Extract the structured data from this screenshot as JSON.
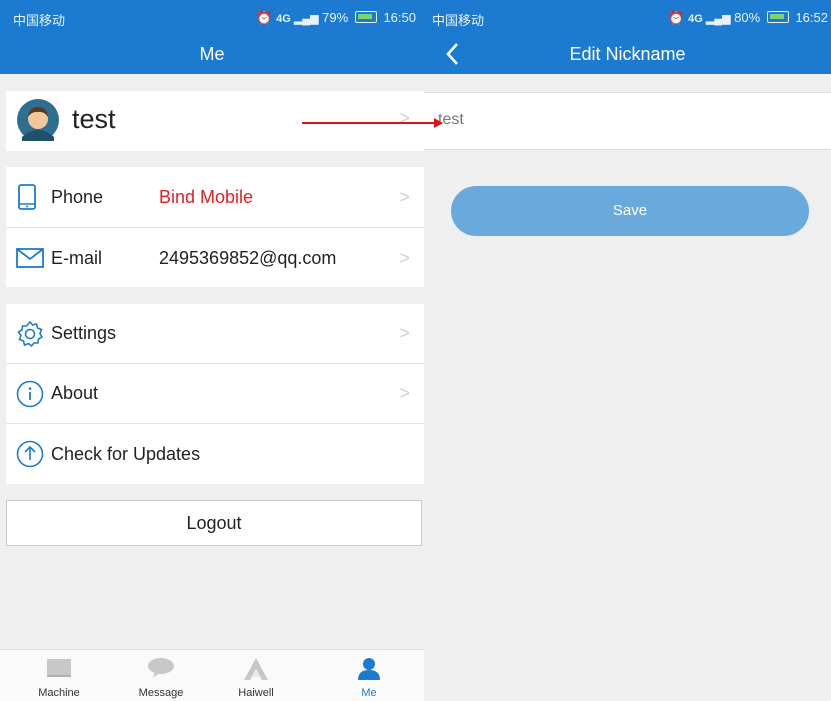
{
  "left_screen": {
    "status": {
      "carrier": "中国移动",
      "battery": "79%",
      "time": "16:50"
    },
    "title": "Me",
    "profile": {
      "name": "test"
    },
    "rows": {
      "phone": {
        "label": "Phone",
        "value": "Bind Mobile",
        "value_color": "#e31e1e"
      },
      "email": {
        "label": "E-mail",
        "value": "2495369852@qq.com"
      },
      "settings": {
        "label": "Settings"
      },
      "about": {
        "label": "About"
      },
      "updates": {
        "label": "Check for Updates"
      }
    },
    "logout_label": "Logout",
    "tabs": [
      {
        "label": "Machine",
        "icon": "machine-icon",
        "active": false
      },
      {
        "label": "Message",
        "icon": "message-icon",
        "active": false
      },
      {
        "label": "Haiwell",
        "icon": "haiwell-icon",
        "active": false
      },
      {
        "label": "Me",
        "icon": "person-icon",
        "active": true
      }
    ],
    "chevron": ">"
  },
  "right_screen": {
    "status": {
      "carrier": "中国移动",
      "battery": "80%",
      "time": "16:52"
    },
    "title": "Edit Nickname",
    "nickname_value": "test",
    "save_label": "Save"
  },
  "colors": {
    "brand": "#1c7bd0",
    "active_tab": "#1c7bd0",
    "annotation_arrow": "#d9141b",
    "save_button": "#6aa9db"
  }
}
